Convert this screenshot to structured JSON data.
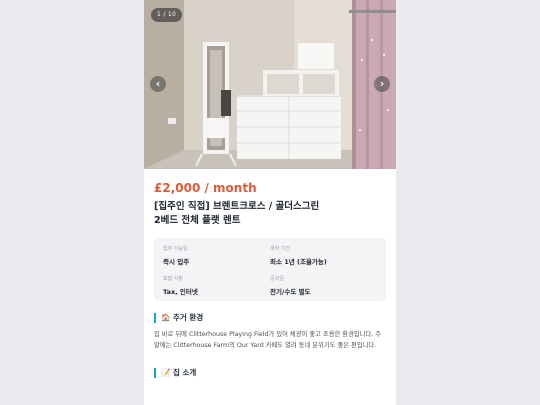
{
  "gallery": {
    "counter": "1 / 10",
    "prev_icon": "chevron-left-icon",
    "next_icon": "chevron-right-icon",
    "prev_glyph": "‹",
    "next_glyph": "›"
  },
  "listing": {
    "price": "£2,000 / month",
    "title_line1": "[집주인 직접] 브렌트크로스 / 골더스그린",
    "title_line2": "2베드 전체 플랫 렌트"
  },
  "details": [
    {
      "label": "입주 가능일",
      "value": "즉시 입주"
    },
    {
      "label": "계약 기간",
      "value": "최소 1년 (조율가능)"
    },
    {
      "label": "포함 사항",
      "value": "Tax, 인터넷"
    },
    {
      "label": "공과금",
      "value": "전기/수도 별도"
    }
  ],
  "sections": [
    {
      "icon": "house-icon",
      "heading": "🏠 주거 환경",
      "body": "집 바로 뒤에 Clitterhouse Playing Field가 있어 채광이 좋고 조용한 환경입니다. 주말에는 Clitterhouse Farm의 Our Yard 카페도 열려 동네 분위기도 좋은 편입니다."
    },
    {
      "icon": "memo-icon",
      "heading": "📝 집 소개"
    }
  ],
  "colors": {
    "price": "#e05a33",
    "accent_bar": "#16a3c2"
  }
}
